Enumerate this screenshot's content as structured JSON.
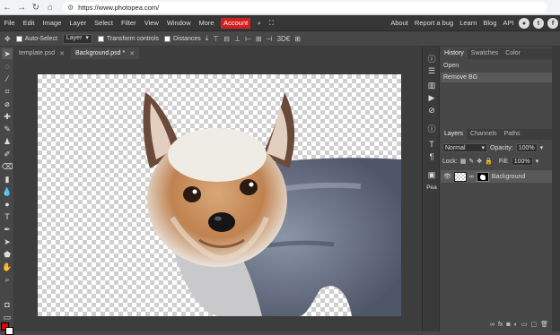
{
  "browser": {
    "url": "https://www.photopea.com/"
  },
  "menu": {
    "items": [
      "File",
      "Edit",
      "Image",
      "Layer",
      "Select",
      "Filter",
      "View",
      "Window",
      "More"
    ],
    "account": "Account",
    "right_links": [
      "About",
      "Report a bug",
      "Learn",
      "Blog",
      "API"
    ]
  },
  "options": {
    "auto_select": "Auto-Select",
    "target": "Layer",
    "transform_controls": "Transform controls",
    "distances": "Distances",
    "label_3d": "3D€"
  },
  "tabs": [
    {
      "label": "template.psd"
    },
    {
      "label": "Background.psd *"
    }
  ],
  "history_panel": {
    "tabs": [
      "History",
      "Swatches",
      "Color"
    ],
    "items": [
      "Open",
      "Remove BG"
    ]
  },
  "layers_panel": {
    "tabs": [
      "Layers",
      "Channels",
      "Paths"
    ],
    "blend_mode": "Normal",
    "opacity_label": "Opacity:",
    "opacity": "100%",
    "lock_label": "Lock:",
    "fill_label": "Fill:",
    "fill": "100%",
    "layer_name": "Background"
  },
  "iconstrip": {
    "pea": "Pea"
  },
  "colors": {
    "account_bg": "#d12020",
    "foreground": "#e00000",
    "background": "#ffffff"
  }
}
